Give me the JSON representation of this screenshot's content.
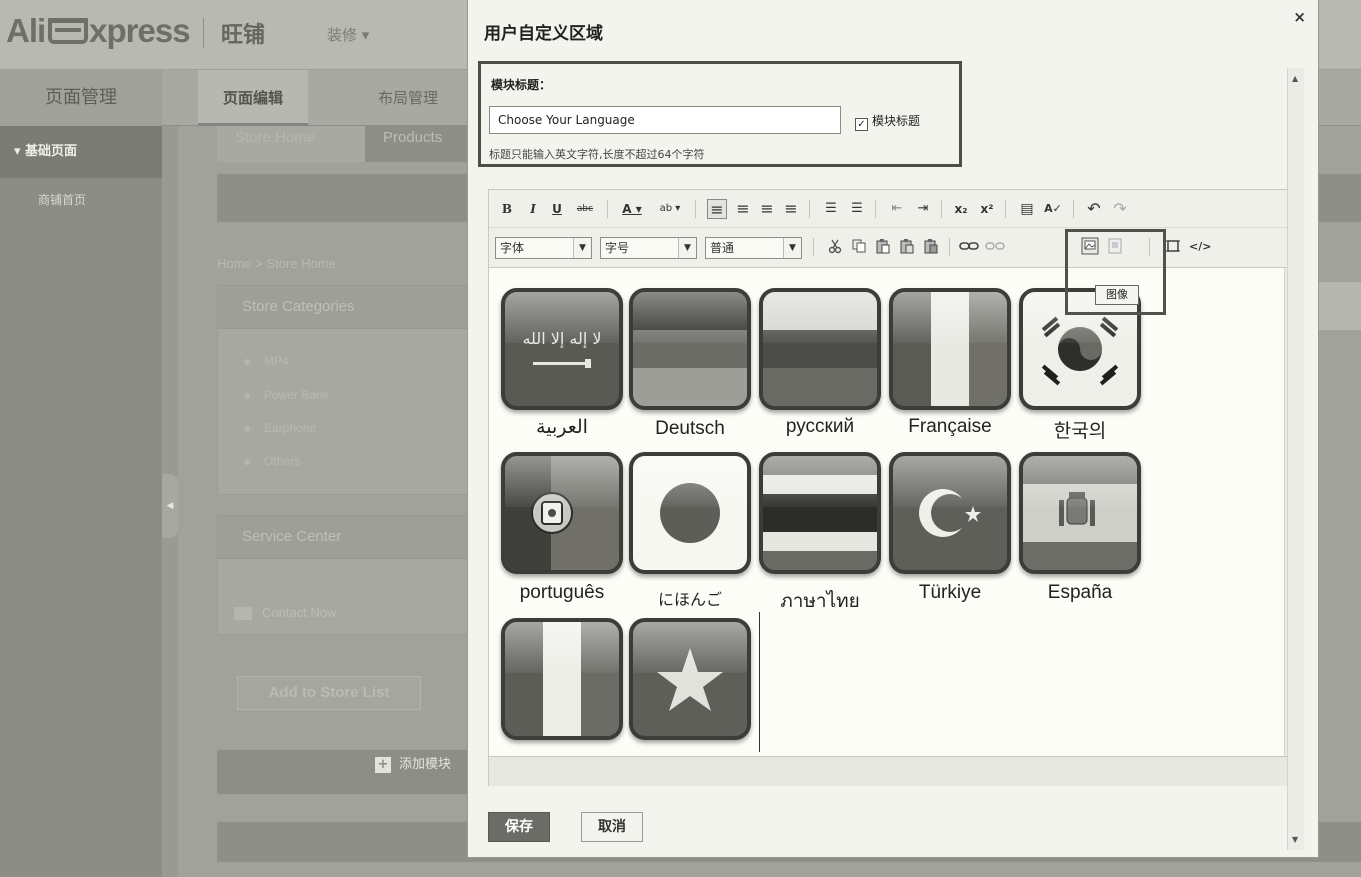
{
  "app": {
    "logo_left": "Ali",
    "logo_right": "xpress",
    "brand": "旺铺",
    "decor_menu": "装修 ▾"
  },
  "nav": {
    "page_management": "页面管理",
    "tabs": [
      {
        "label": "页面编辑",
        "active": true
      },
      {
        "label": "布局管理",
        "active": false
      }
    ]
  },
  "sidebar": {
    "group_label": "▾ 基础页面",
    "items": [
      {
        "label": "商铺首页"
      }
    ]
  },
  "background": {
    "store_tabs": [
      "Store Home",
      "Products"
    ],
    "breadcrumb": "Home > Store Home",
    "store_categories_title": "Store Categories",
    "categories": [
      "MP4",
      "Power Bank",
      "Earphone",
      "Others"
    ],
    "service_center_title": "Service Center",
    "contact_now": "Contact Now",
    "add_to_store_list": "Add to Store List",
    "add_module": "添加模块"
  },
  "modal": {
    "title": "用户自定义区域",
    "close": "×",
    "field_label": "模块标题：",
    "title_input_value": "Choose Your Language",
    "show_title_checkbox_label": "模块标题",
    "show_title_checked": true,
    "hint": "标题只能输入英文字符,长度不超过64个字符",
    "save_button": "保存",
    "cancel_button": "取消"
  },
  "editor": {
    "toolbar_row1": [
      {
        "name": "bold-button",
        "label": "B"
      },
      {
        "name": "italic-button",
        "label": "I"
      },
      {
        "name": "underline-button",
        "label": "U"
      },
      {
        "name": "strikethrough-button",
        "label": "abc"
      },
      {
        "name": "font-color-button",
        "label": "A ▾"
      },
      {
        "name": "highlight-color-button",
        "label": "ab ▾"
      },
      {
        "name": "align-left-button",
        "label": "≡"
      },
      {
        "name": "align-center-button",
        "label": "≡"
      },
      {
        "name": "align-right-button",
        "label": "≡"
      },
      {
        "name": "align-justify-button",
        "label": "≡"
      },
      {
        "name": "bullet-list-button",
        "label": "☰"
      },
      {
        "name": "numbered-list-button",
        "label": "☰"
      },
      {
        "name": "outdent-button",
        "label": "⇤"
      },
      {
        "name": "indent-button",
        "label": "⇥"
      },
      {
        "name": "subscript-button",
        "label": "x₂"
      },
      {
        "name": "superscript-button",
        "label": "x²"
      },
      {
        "name": "insert-template-button",
        "label": "▤"
      },
      {
        "name": "spellcheck-button",
        "label": "A✓"
      },
      {
        "name": "undo-button",
        "label": "↶"
      },
      {
        "name": "redo-button",
        "label": "↷"
      }
    ],
    "font_select": "字体",
    "size_select": "字号",
    "format_select": "普通",
    "tooltip_image": "图像",
    "flags": [
      {
        "label": "العربية",
        "icon": "saudi-arabia-flag-icon"
      },
      {
        "label": "Deutsch",
        "icon": "germany-flag-icon"
      },
      {
        "label": "русский",
        "icon": "russia-flag-icon"
      },
      {
        "label": "Française",
        "icon": "france-flag-icon"
      },
      {
        "label": "한국의",
        "icon": "south-korea-flag-icon"
      },
      {
        "label": "português",
        "icon": "portugal-flag-icon"
      },
      {
        "label": "にほんご",
        "icon": "japan-flag-icon"
      },
      {
        "label": "ภาษาไทย",
        "icon": "thailand-flag-icon"
      },
      {
        "label": "Türkiye",
        "icon": "turkey-flag-icon"
      },
      {
        "label": "España",
        "icon": "spain-flag-icon"
      },
      {
        "label": "",
        "icon": "italy-flag-icon"
      },
      {
        "label": "",
        "icon": "vietnam-flag-icon"
      }
    ]
  }
}
